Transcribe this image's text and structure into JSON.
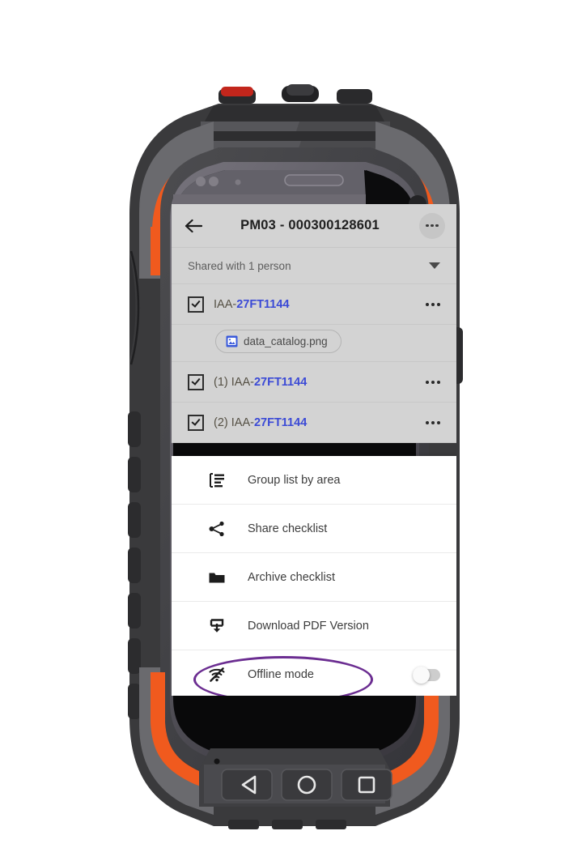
{
  "app": {
    "bar": {
      "back_icon": "back-arrow-icon",
      "title": "PM03 - 000300128601",
      "overflow_icon": "overflow-menu-icon"
    },
    "shared": {
      "label": "Shared with 1 person",
      "caret_icon": "chevron-down-icon"
    },
    "checklist": [
      {
        "checked": true,
        "prefix": "",
        "base": "IAA-",
        "highlight": "27FT1144",
        "row_menu_icon": "row-overflow-icon"
      },
      {
        "checked": true,
        "prefix": "(1) ",
        "base": "IAA-",
        "highlight": "27FT1144",
        "row_menu_icon": "row-overflow-icon"
      },
      {
        "checked": true,
        "prefix": "(2) ",
        "base": "IAA-",
        "highlight": "27FT1144",
        "row_menu_icon": "row-overflow-icon"
      }
    ],
    "attachment": {
      "icon": "image-file-icon",
      "filename": "data_catalog.png"
    },
    "menu": [
      {
        "icon": "group-list-icon",
        "label": "Group list by area"
      },
      {
        "icon": "share-icon",
        "label": "Share checklist"
      },
      {
        "icon": "folder-icon",
        "label": "Archive checklist"
      },
      {
        "icon": "download-icon",
        "label": "Download PDF Version"
      },
      {
        "icon": "wifi-off-icon",
        "label": "Offline mode",
        "toggle": "off"
      }
    ]
  },
  "device": {
    "nav_buttons": [
      {
        "name": "back-nav-button",
        "icon": "triangle-left-icon"
      },
      {
        "name": "home-nav-button",
        "icon": "circle-icon"
      },
      {
        "name": "recents-nav-button",
        "icon": "square-icon"
      }
    ]
  },
  "colors": {
    "accent_orange": "#f05a1e",
    "body_dark": "#3a3a3c",
    "body_mid": "#57575a",
    "highlight_blue": "#3b4ad6",
    "annotation_purple": "#6b2d91",
    "appbar_gray": "#d3d3d3"
  }
}
